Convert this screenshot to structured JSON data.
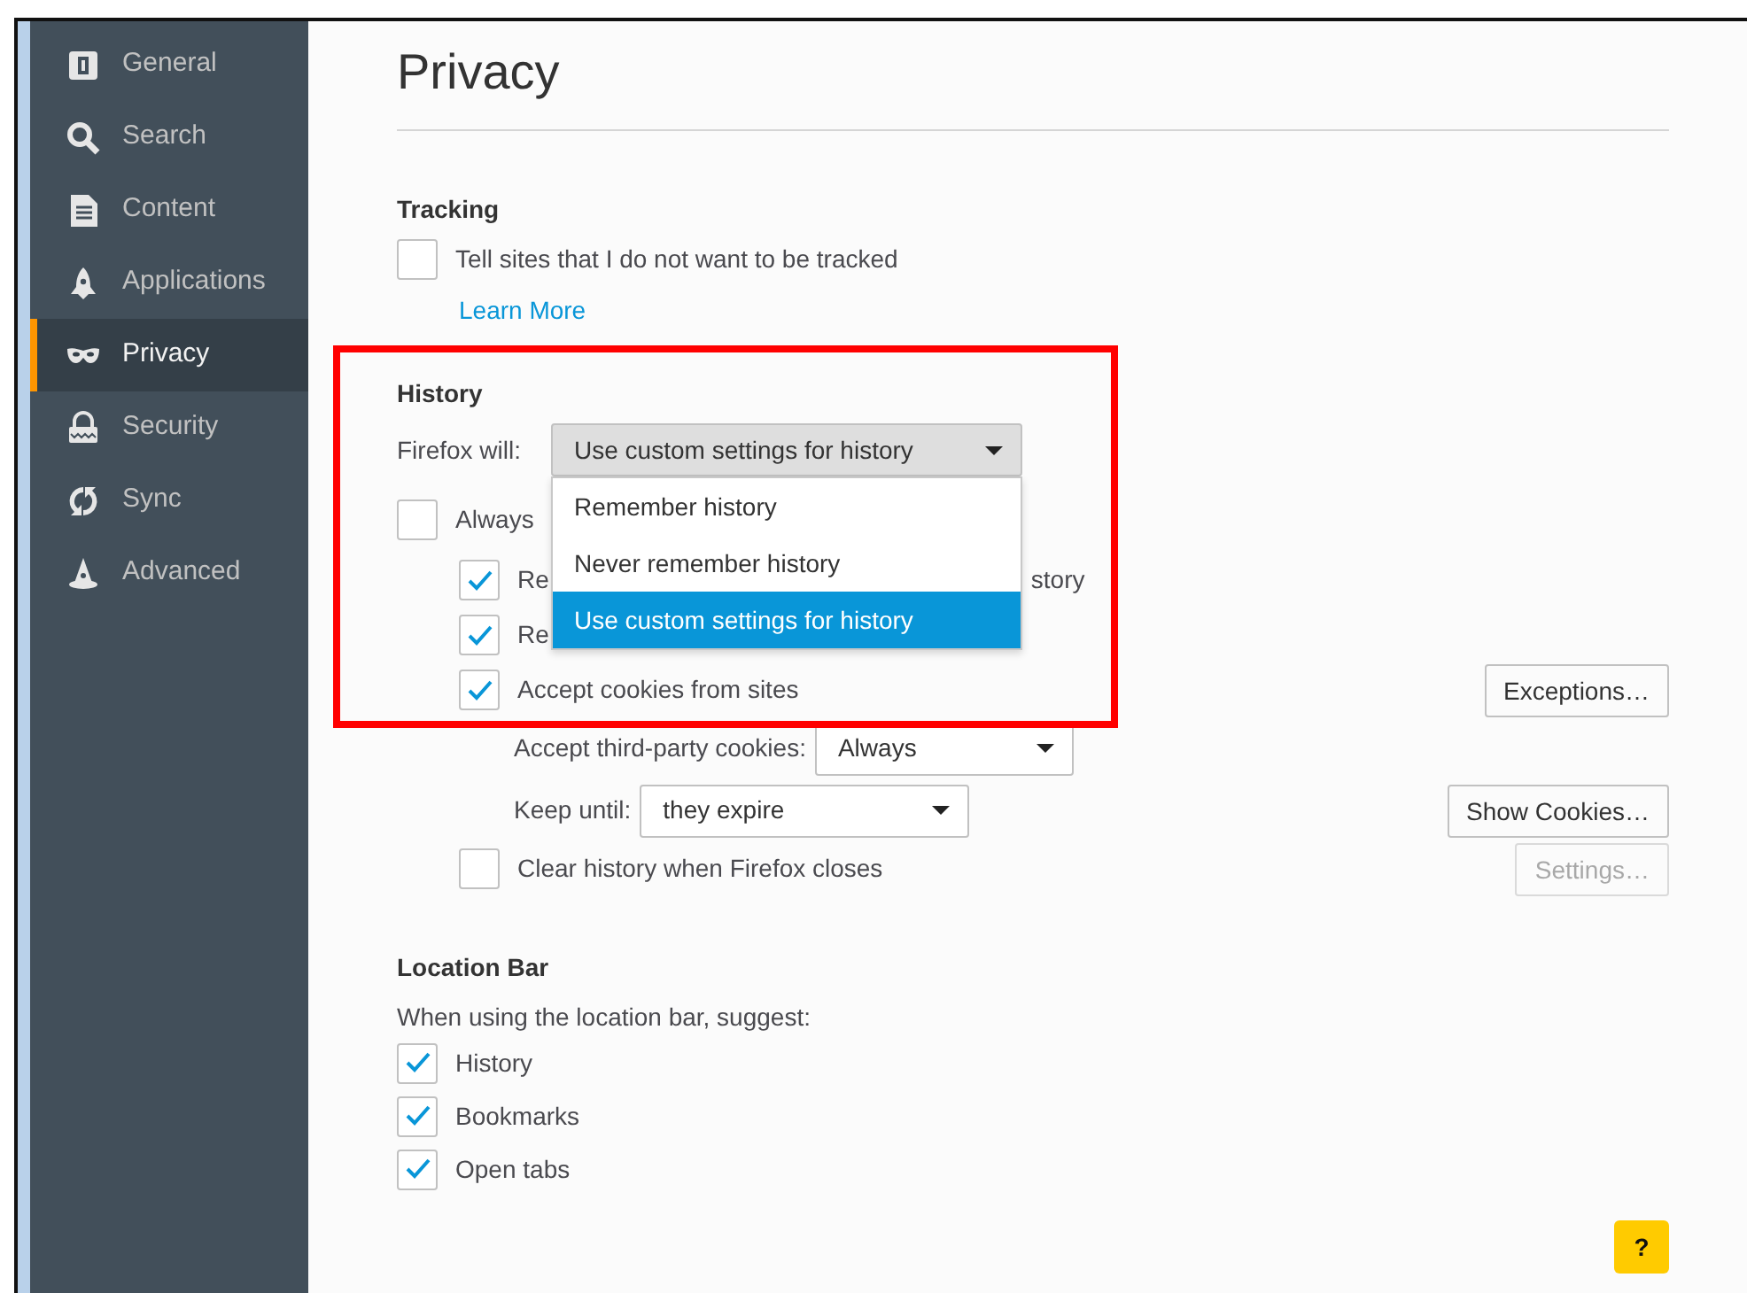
{
  "sidebar": {
    "items": [
      {
        "label": "General",
        "selected": false
      },
      {
        "label": "Search",
        "selected": false
      },
      {
        "label": "Content",
        "selected": false
      },
      {
        "label": "Applications",
        "selected": false
      },
      {
        "label": "Privacy",
        "selected": true
      },
      {
        "label": "Security",
        "selected": false
      },
      {
        "label": "Sync",
        "selected": false
      },
      {
        "label": "Advanced",
        "selected": false
      }
    ]
  },
  "page_title": "Privacy",
  "tracking": {
    "heading": "Tracking",
    "checkbox": {
      "label": "Tell sites that I do not want to be tracked",
      "checked": false
    },
    "link": "Learn More"
  },
  "history": {
    "heading": "History",
    "highlight_frame": true,
    "mode": {
      "label": "Firefox will:",
      "value": "Use custom settings for history",
      "expanded": true,
      "options": [
        {
          "label": "Remember history",
          "selected": false
        },
        {
          "label": "Never remember history",
          "selected": false
        },
        {
          "label": "Use custom settings for history",
          "selected": true
        }
      ]
    },
    "rows": [
      {
        "kind": "checkbox",
        "label": "Always",
        "checked": false,
        "children": [
          {
            "kind": "checkbox",
            "label": "Re",
            "label_end": "story",
            "checked": true
          },
          {
            "kind": "checkbox",
            "label": "Re",
            "checked": true
          },
          {
            "kind": "checkbox",
            "label": "Accept cookies from sites",
            "checked": true,
            "button": {
              "label": "Exceptions…",
              "disabled": false
            },
            "children": [
              {
                "kind": "select",
                "label": "Accept third-party cookies:",
                "value": "Always"
              },
              {
                "kind": "select",
                "label": "Keep until:",
                "value": "they expire",
                "button": {
                  "label": "Show Cookies…",
                  "disabled": false
                }
              }
            ]
          },
          {
            "kind": "checkbox",
            "label": "Clear history when Firefox closes",
            "checked": false,
            "button": {
              "label": "Settings…",
              "disabled": true
            }
          }
        ]
      }
    ]
  },
  "location_bar": {
    "heading": "Location Bar",
    "intro": "When using the location bar, suggest:",
    "options": [
      {
        "label": "History",
        "checked": true
      },
      {
        "label": "Bookmarks",
        "checked": true
      },
      {
        "label": "Open tabs",
        "checked": true
      }
    ]
  },
  "help_button": {
    "label": "?"
  }
}
